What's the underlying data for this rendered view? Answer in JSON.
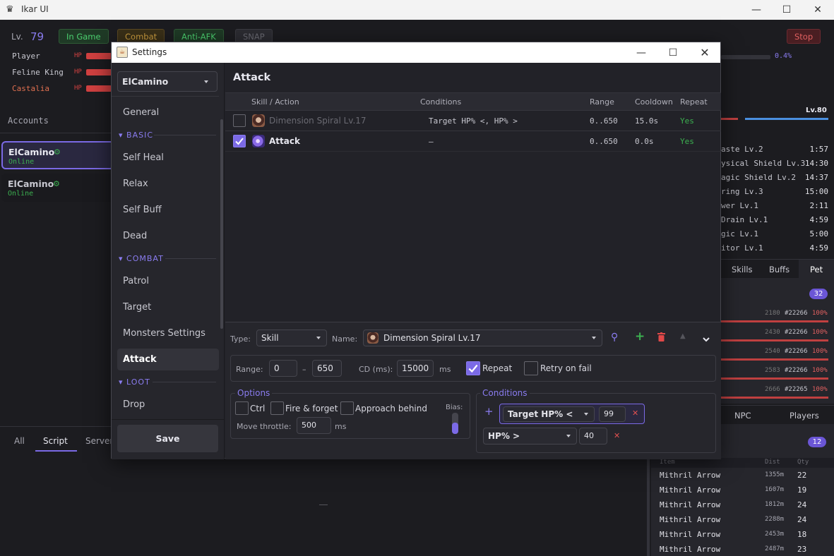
{
  "app": {
    "title": "Ikar UI"
  },
  "top": {
    "level_label": "Lv.",
    "level": "79",
    "badges": [
      "In Game",
      "Combat",
      "Anti-AFK",
      "SNAP"
    ],
    "stop": "Stop",
    "percent": "0.4%"
  },
  "party": [
    {
      "name": "Player",
      "hp": "HP"
    },
    {
      "name": "Feline King",
      "hp": "HP"
    },
    {
      "name": "Castalia",
      "hp": "HP"
    }
  ],
  "accounts": {
    "title": "Accounts",
    "items": [
      {
        "name": "ElCamino",
        "status": "Online"
      },
      {
        "name": "ElCamino",
        "status": "Online"
      }
    ]
  },
  "bottom_tabs": [
    "All",
    "Script",
    "Server"
  ],
  "right": {
    "level": "Lv.80",
    "buffs": [
      {
        "name": "aste Lv.2",
        "time": "1:57"
      },
      {
        "name": "ysical Shield Lv.3",
        "time": "14:30"
      },
      {
        "name": "agic Shield Lv.2",
        "time": "14:37"
      },
      {
        "name": "ring Lv.3",
        "time": "15:00"
      },
      {
        "name": "wer Lv.1",
        "time": "2:11"
      },
      {
        "name": " Drain Lv.1",
        "time": "4:59"
      },
      {
        "name": "gic Lv.1",
        "time": "5:00"
      },
      {
        "name": "itor Lv.1",
        "time": "4:59"
      }
    ],
    "tabs": [
      "Skills",
      "Buffs",
      "Pet"
    ],
    "pet_count": "32",
    "pet_rows": [
      {
        "num": "2180",
        "id": "#22266",
        "pct": "100%"
      },
      {
        "num": "2430",
        "id": "#22266",
        "pct": "100%"
      },
      {
        "num": "2540",
        "id": "#22266",
        "pct": "100%"
      },
      {
        "num": "2583",
        "id": "#22266",
        "pct": "100%"
      },
      {
        "num": "2666",
        "id": "#22265",
        "pct": "100%"
      }
    ],
    "tabs2": [
      "NPC",
      "Players"
    ],
    "drop_count": "12",
    "drop_headers": [
      "Item",
      "Dist",
      "Qty"
    ],
    "drops": [
      {
        "item": "Mithril Arrow",
        "dist": "1355m",
        "qty": "22"
      },
      {
        "item": "Mithril Arrow",
        "dist": "1607m",
        "qty": "19"
      },
      {
        "item": "Mithril Arrow",
        "dist": "1812m",
        "qty": "24"
      },
      {
        "item": "Mithril Arrow",
        "dist": "2288m",
        "qty": "24"
      },
      {
        "item": "Mithril Arrow",
        "dist": "2453m",
        "qty": "18"
      },
      {
        "item": "Mithril Arrow",
        "dist": "2487m",
        "qty": "23"
      }
    ]
  },
  "dialog": {
    "title": "Settings",
    "account": "ElCamino",
    "nav": {
      "general": "General",
      "basic": "BASIC",
      "self_heal": "Self Heal",
      "relax": "Relax",
      "self_buff": "Self Buff",
      "dead": "Dead",
      "combat": "COMBAT",
      "patrol": "Patrol",
      "target": "Target",
      "monsters": "Monsters Settings",
      "attack": "Attack",
      "loot": "LOOT",
      "drop": "Drop"
    },
    "save": "Save",
    "heading": "Attack",
    "table": {
      "headers": [
        "Skill / Action",
        "Conditions",
        "Range",
        "Cooldown",
        "Repeat"
      ],
      "rows": [
        {
          "name": "Dimension Spiral Lv.17",
          "cond": "Target HP% <, HP% >",
          "range": "0..650",
          "cd": "15.0s",
          "repeat": "Yes"
        },
        {
          "name": "Attack",
          "cond": "—",
          "range": "0..650",
          "cd": "0.0s",
          "repeat": "Yes"
        }
      ]
    },
    "form": {
      "type_label": "Type:",
      "type": "Skill",
      "name_label": "Name:",
      "name": "Dimension Spiral Lv.17",
      "range_label": "Range:",
      "range_min": "0",
      "range_sep": "–",
      "range_max": "650",
      "cd_label": "CD (ms):",
      "cd": "15000",
      "cd_unit": "ms",
      "repeat": "Repeat",
      "retry": "Retry on fail",
      "options_title": "Options",
      "ctrl": "Ctrl",
      "fire": "Fire & forget",
      "approach": "Approach behind",
      "bias": "Bias:",
      "throttle_label": "Move throttle:",
      "throttle": "500",
      "throttle_unit": "ms",
      "conditions_title": "Conditions",
      "cond1": "Target HP% <",
      "cond1_val": "99",
      "cond2": "HP% >",
      "cond2_val": "40"
    }
  },
  "colors": {
    "accent": "#7b6ae6",
    "online": "#3cb050",
    "hp": "#d04040"
  }
}
